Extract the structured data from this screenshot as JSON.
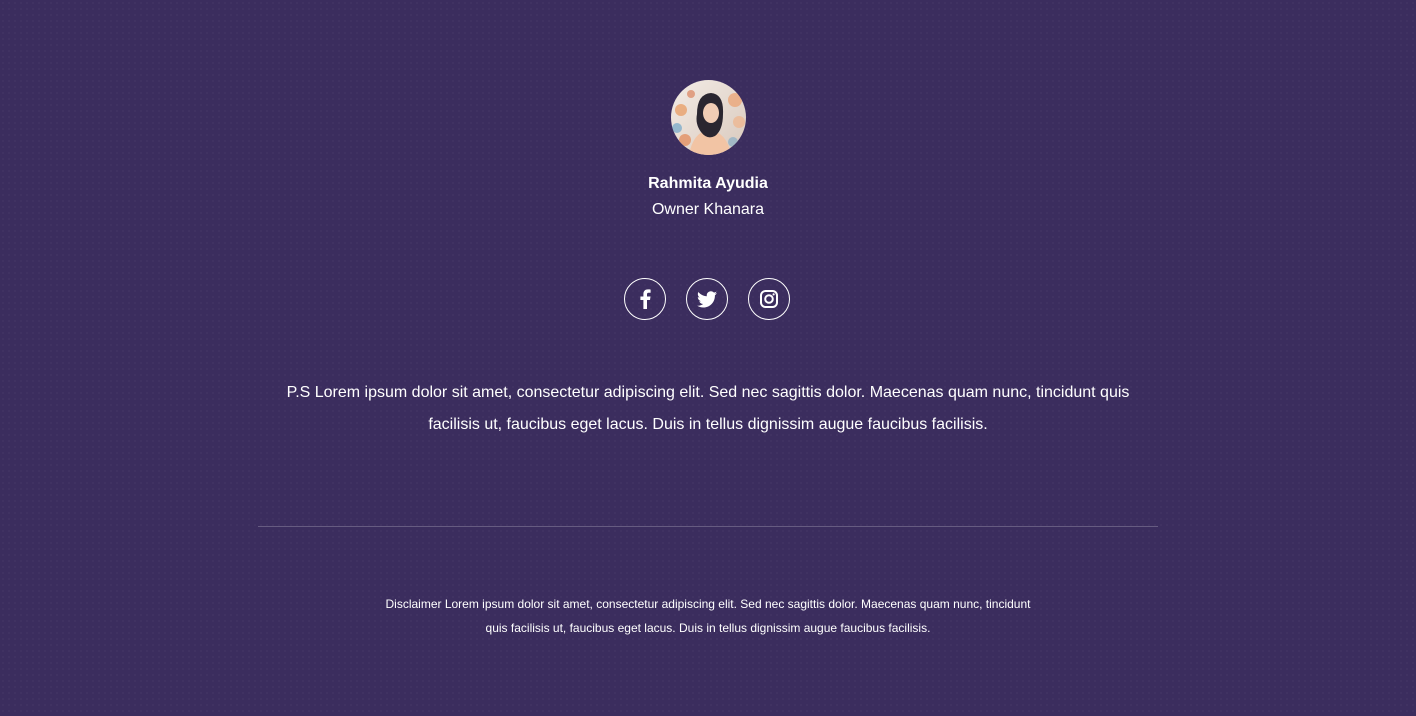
{
  "profile": {
    "avatar_alt": "Rahmita Ayudia",
    "name": "Rahmita Ayudia",
    "role": "Owner Khanara"
  },
  "socials": [
    {
      "icon": "facebook-icon"
    },
    {
      "icon": "twitter-icon"
    },
    {
      "icon": "instagram-icon"
    }
  ],
  "ps_text": "P.S Lorem ipsum dolor sit amet, consectetur adipiscing elit. Sed nec sagittis dolor. Maecenas quam nunc, tincidunt quis facilisis ut, faucibus eget lacus. Duis in tellus dignissim augue faucibus facilisis.",
  "disclaimer": "Disclaimer Lorem ipsum dolor sit amet, consectetur adipiscing elit. Sed nec sagittis dolor. Maecenas quam nunc, tincidunt quis facilisis ut, faucibus eget lacus. Duis in tellus dignissim augue faucibus facilisis.",
  "colors": {
    "background": "#3b2d5e",
    "text": "#ffffff"
  }
}
